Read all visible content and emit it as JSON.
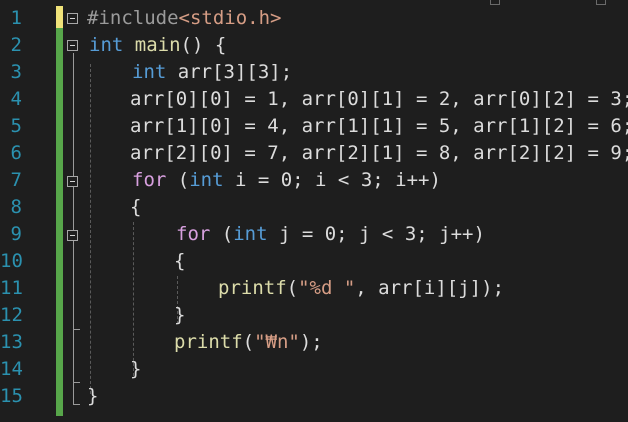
{
  "editor": {
    "line_numbers": [
      "1",
      "2",
      "3",
      "4",
      "5",
      "6",
      "7",
      "8",
      "9",
      "10",
      "11",
      "12",
      "13",
      "14",
      "15"
    ],
    "colors": {
      "background": "#1e1e1e",
      "line_number": "#2b91af",
      "change_bar": "#57a64a",
      "keyword": "#569cd6",
      "control": "#d8a0df",
      "preprocessor": "#9b9b9b",
      "string": "#d69d85",
      "function": "#dcdcaa",
      "text": "#dcdcdc"
    },
    "lines": [
      {
        "tokens": [
          {
            "t": "#include",
            "c": "pp"
          },
          {
            "t": "<stdio.h>",
            "c": "str"
          }
        ]
      },
      {
        "tokens": [
          {
            "t": "int",
            "c": "kw"
          },
          {
            "t": " ",
            "c": "plain"
          },
          {
            "t": "main",
            "c": "fn"
          },
          {
            "t": "() {",
            "c": "plain"
          }
        ]
      },
      {
        "tokens": [
          {
            "t": "int",
            "c": "kw"
          },
          {
            "t": " arr[3][3];",
            "c": "plain"
          }
        ]
      },
      {
        "tokens": [
          {
            "t": "arr[0][0] = 1, arr[0][1] = 2, arr[0][2] = 3;",
            "c": "plain"
          }
        ]
      },
      {
        "tokens": [
          {
            "t": "arr[1][0] = 4, arr[1][1] = 5, arr[1][2] = 6;",
            "c": "plain"
          }
        ]
      },
      {
        "tokens": [
          {
            "t": "arr[2][0] = 7, arr[2][1] = 8, arr[2][2] = 9;",
            "c": "plain"
          }
        ]
      },
      {
        "tokens": [
          {
            "t": "for",
            "c": "ctl"
          },
          {
            "t": " (",
            "c": "plain"
          },
          {
            "t": "int",
            "c": "kw"
          },
          {
            "t": " i = 0; i < 3; i++)",
            "c": "plain"
          }
        ]
      },
      {
        "tokens": [
          {
            "t": "{",
            "c": "plain"
          }
        ]
      },
      {
        "tokens": [
          {
            "t": "for",
            "c": "ctl"
          },
          {
            "t": " (",
            "c": "plain"
          },
          {
            "t": "int",
            "c": "kw"
          },
          {
            "t": " j = 0; j < 3; j++)",
            "c": "plain"
          }
        ]
      },
      {
        "tokens": [
          {
            "t": "{",
            "c": "plain"
          }
        ]
      },
      {
        "tokens": [
          {
            "t": "printf",
            "c": "fn"
          },
          {
            "t": "(",
            "c": "plain"
          },
          {
            "t": "\"%d \"",
            "c": "str"
          },
          {
            "t": ", arr[i][j]);",
            "c": "plain"
          }
        ]
      },
      {
        "tokens": [
          {
            "t": "}",
            "c": "plain"
          }
        ]
      },
      {
        "tokens": [
          {
            "t": "printf",
            "c": "fn"
          },
          {
            "t": "(",
            "c": "plain"
          },
          {
            "t": "\"₩n\"",
            "c": "str"
          },
          {
            "t": ");",
            "c": "plain"
          }
        ]
      },
      {
        "tokens": [
          {
            "t": "}",
            "c": "plain"
          }
        ]
      },
      {
        "tokens": [
          {
            "t": "}",
            "c": "plain"
          }
        ]
      }
    ]
  }
}
